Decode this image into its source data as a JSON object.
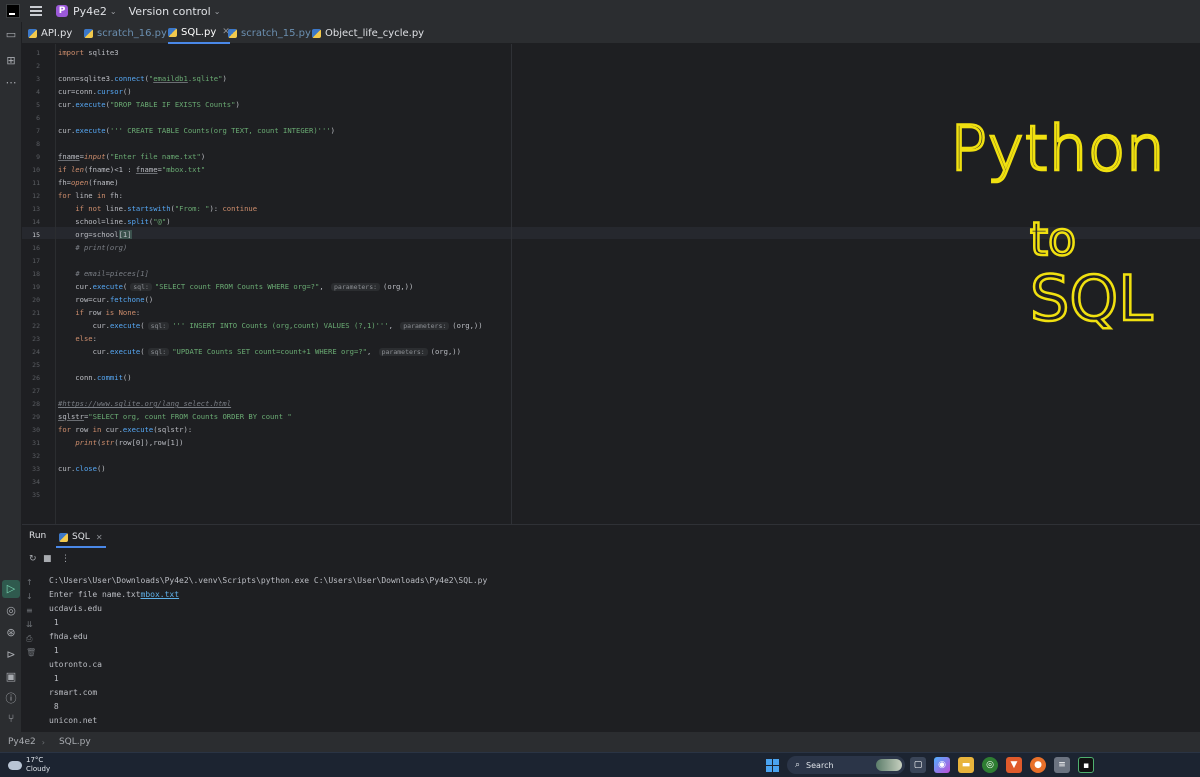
{
  "titlebar": {
    "project_badge": "P",
    "project_name": "Py4e2",
    "version_control": "Version control"
  },
  "tabs": [
    {
      "label": "API.py",
      "dim": false,
      "active": false
    },
    {
      "label": "scratch_16.py",
      "dim": true,
      "active": false
    },
    {
      "label": "SQL.py",
      "dim": false,
      "active": true
    },
    {
      "label": "scratch_15.py",
      "dim": true,
      "active": false
    },
    {
      "label": "Object_life_cycle.py",
      "dim": false,
      "active": false
    }
  ],
  "editor": {
    "current_line": 15,
    "line_count": 35
  },
  "handwriting": {
    "line1": "Python",
    "line2": "to",
    "line3": "SQL",
    "color": "#f0e010"
  },
  "run_panel": {
    "title": "Run",
    "tab_label": "SQL"
  },
  "console": {
    "lines": [
      "C:\\Users\\User\\Downloads\\Py4e2\\.venv\\Scripts\\python.exe C:\\Users\\User\\Downloads\\Py4e2\\SQL.py",
      "Enter file name.txt",
      "ucdavis.edu",
      " 1",
      "fhda.edu",
      " 1",
      "utoronto.ca",
      " 1",
      "rsmart.com",
      " 8",
      "unicon.net"
    ],
    "input_echo": "mbox.txt"
  },
  "statusbar": {
    "project": "Py4e2",
    "file": "SQL.py"
  },
  "taskbar": {
    "temperature": "17°C",
    "condition": "Cloudy",
    "search_label": "Search"
  },
  "colors": {
    "accent": "#4a88e8",
    "handwriting": "#f0e010",
    "string": "#6aab73",
    "keyword": "#cf8e6d",
    "function": "#56a8f5"
  }
}
